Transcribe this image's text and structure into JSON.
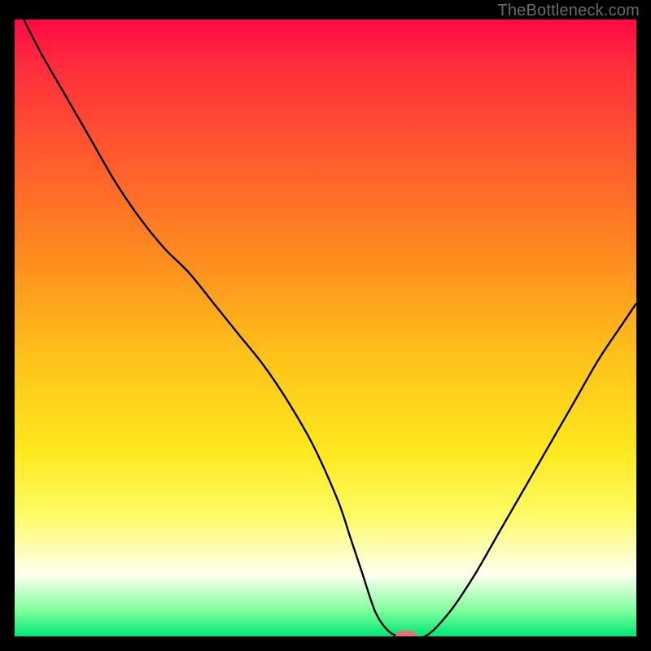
{
  "watermark": "TheBottleneck.com",
  "colors": {
    "background": "#000000",
    "watermark_text": "#6a6a6a",
    "curve_stroke": "#000000",
    "marker_fill": "#e57373",
    "gradient_stops": [
      "#ff0b44",
      "#ff2f3d",
      "#ff5a2e",
      "#ff8a1f",
      "#ffc31a",
      "#ffe81e",
      "#fffb62",
      "#ffffef",
      "#7aff9a",
      "#00e676"
    ]
  },
  "chart_data": {
    "type": "line",
    "title": "",
    "xlabel": "",
    "ylabel": "",
    "x_range": [
      0,
      100
    ],
    "y_range": [
      0,
      100
    ],
    "series": [
      {
        "name": "bottleneck-curve",
        "x": [
          0,
          4,
          8,
          12,
          16,
          20,
          24,
          28,
          32,
          36,
          40,
          44,
          48,
          52,
          54,
          56,
          58,
          60,
          62,
          66,
          70,
          74,
          78,
          82,
          86,
          90,
          94,
          98,
          100
        ],
        "y": [
          103,
          95,
          88,
          81,
          74,
          68,
          63,
          59,
          54,
          49,
          44,
          38,
          31,
          22,
          16,
          10,
          4,
          1,
          0,
          0,
          4,
          10,
          17,
          24,
          31,
          38,
          45,
          51,
          54
        ]
      }
    ],
    "marker": {
      "x": 63,
      "y": 0,
      "label": "optimal-point"
    },
    "note": "x/y are percentages of the plot area; y increases upward. Values are approximate readings from the unlabeled chart."
  }
}
